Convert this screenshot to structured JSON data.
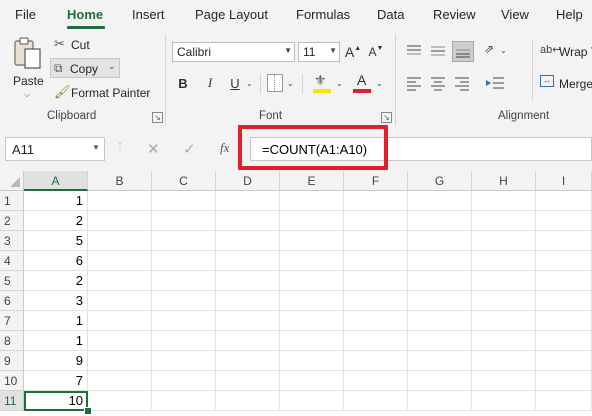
{
  "menu": {
    "tabs": [
      {
        "label": "File"
      },
      {
        "label": "Home"
      },
      {
        "label": "Insert"
      },
      {
        "label": "Page Layout"
      },
      {
        "label": "Formulas"
      },
      {
        "label": "Data"
      },
      {
        "label": "Review"
      },
      {
        "label": "View"
      },
      {
        "label": "Help"
      }
    ],
    "active": "Home"
  },
  "ribbon": {
    "clipboard": {
      "paste_label": "Paste",
      "cut_label": "Cut",
      "copy_label": "Copy",
      "format_painter_label": "Format Painter",
      "group_label": "Clipboard"
    },
    "font": {
      "font_name": "Calibri",
      "font_size": "11",
      "bold_label": "B",
      "italic_label": "I",
      "underline_label": "U",
      "grow_label": "A",
      "shrink_label": "A",
      "font_color_label": "A",
      "group_label": "Font",
      "highlight_color": "#f5e600",
      "font_color": "#e0202a"
    },
    "alignment": {
      "wrap_label": "Wrap T",
      "merge_label": "Merge",
      "group_label": "Alignment"
    }
  },
  "formula_bar": {
    "name_box": "A11",
    "fx_label": "fx",
    "formula": "=COUNT(A1:A10)",
    "highlight_color": "#e0202a"
  },
  "grid": {
    "columns": [
      "A",
      "B",
      "C",
      "D",
      "E",
      "F",
      "G",
      "H",
      "I"
    ],
    "selected_column": "A",
    "rows": [
      {
        "row": "1",
        "a": "1"
      },
      {
        "row": "2",
        "a": "2"
      },
      {
        "row": "3",
        "a": "5"
      },
      {
        "row": "4",
        "a": "6"
      },
      {
        "row": "5",
        "a": "2"
      },
      {
        "row": "6",
        "a": "3"
      },
      {
        "row": "7",
        "a": "1"
      },
      {
        "row": "8",
        "a": "1"
      },
      {
        "row": "9",
        "a": "9"
      },
      {
        "row": "10",
        "a": "7"
      },
      {
        "row": "11",
        "a": "10"
      }
    ],
    "active_cell": "A11",
    "accent_color": "#1e6e3c"
  }
}
